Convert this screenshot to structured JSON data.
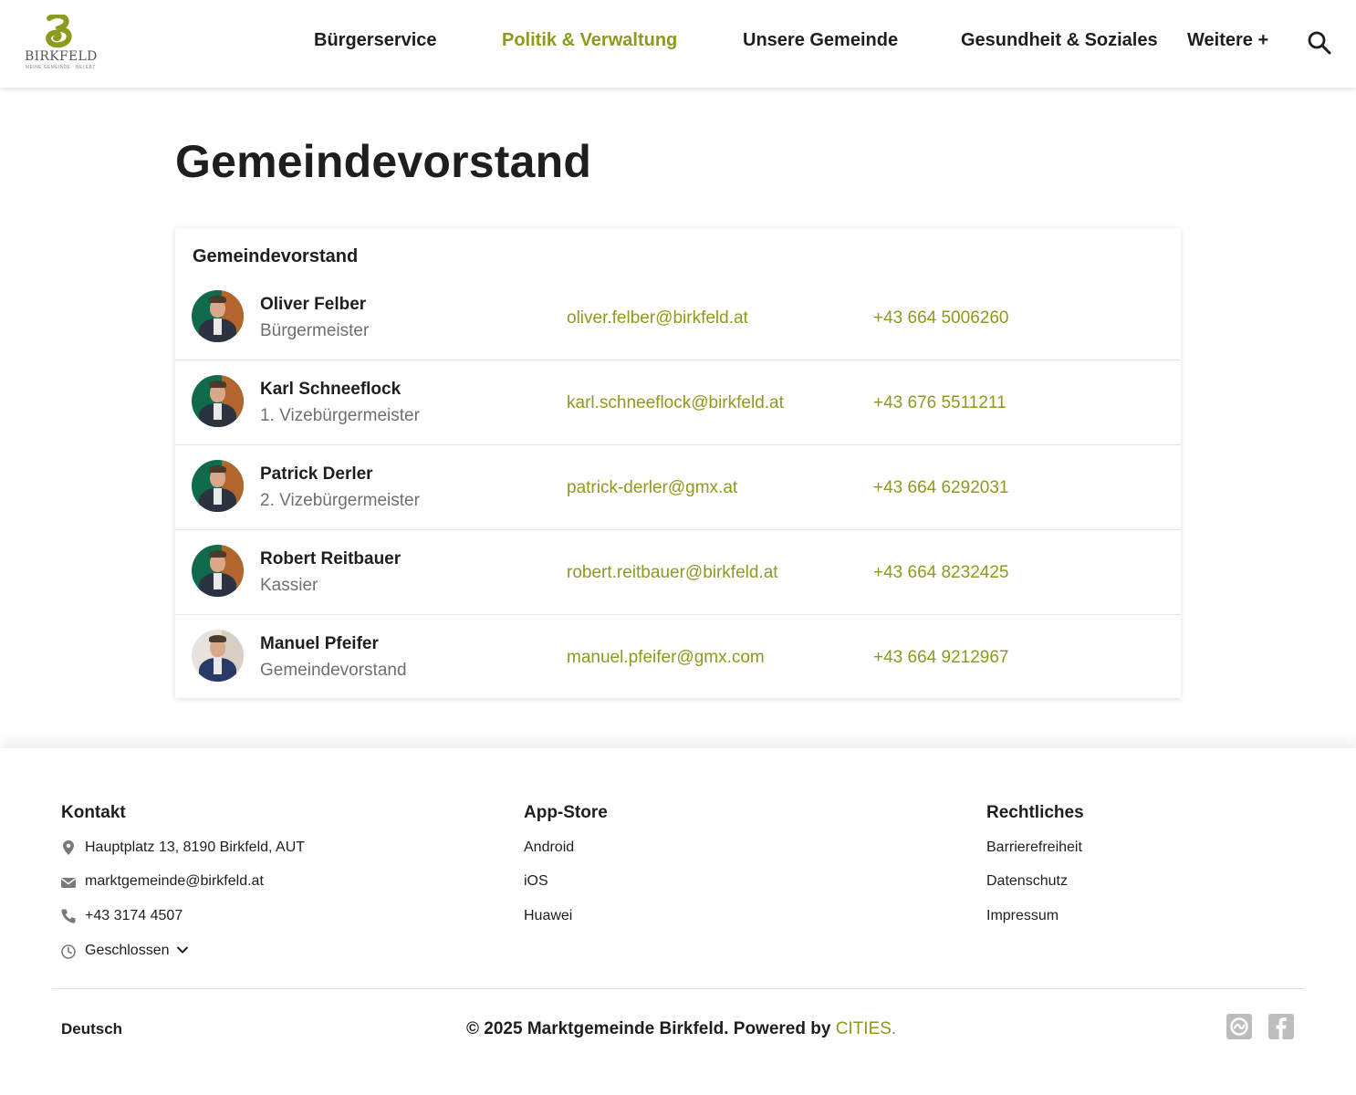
{
  "brand": {
    "name": "BIRKFELD",
    "tagline": "MEINE GEMEINDE · BELEBT",
    "color": "#8c9a1e"
  },
  "nav": {
    "items": [
      {
        "label": "Bürgerservice",
        "active": false
      },
      {
        "label": "Politik & Verwaltung",
        "active": true
      },
      {
        "label": "Unsere Gemeinde",
        "active": false
      },
      {
        "label": "Gesundheit & Soziales",
        "active": false
      },
      {
        "label": "Weitere +",
        "active": false
      }
    ],
    "search_icon": "search-icon"
  },
  "page": {
    "title": "Gemeindevorstand"
  },
  "card": {
    "title": "Gemeindevorstand",
    "members": [
      {
        "name": "Oliver Felber",
        "role": "Bürgermeister",
        "email": "oliver.felber@birkfeld.at",
        "phone": "+43 664 5006260"
      },
      {
        "name": "Karl Schneeflock",
        "role": "1. Vizebürgermeister",
        "email": "karl.schneeflock@birkfeld.at",
        "phone": "+43 676 5511211"
      },
      {
        "name": "Patrick Derler",
        "role": "2. Vizebürgermeister",
        "email": "patrick-derler@gmx.at",
        "phone": "+43 664 6292031"
      },
      {
        "name": "Robert Reitbauer",
        "role": "Kassier",
        "email": "robert.reitbauer@birkfeld.at",
        "phone": "+43 664 8232425"
      },
      {
        "name": "Manuel Pfeifer",
        "role": "Gemeindevorstand",
        "email": "manuel.pfeifer@gmx.com",
        "phone": "+43 664 9212967"
      }
    ]
  },
  "footer": {
    "kontakt": {
      "title": "Kontakt",
      "address": "Hauptplatz 13, 8190 Birkfeld, AUT",
      "email": "marktgemeinde@birkfeld.at",
      "phone": "+43 3174 4507",
      "hours": "Geschlossen"
    },
    "appstore": {
      "title": "App-Store",
      "links": [
        "Android",
        "iOS",
        "Huawei"
      ]
    },
    "legal": {
      "title": "Rechtliches",
      "links": [
        "Barrierefreiheit",
        "Datenschutz",
        "Impressum"
      ]
    },
    "language": "Deutsch",
    "copyright": "© 2025 Marktgemeinde Birkfeld. Powered by",
    "powered_by": "CITIES.",
    "social_icons": [
      "cities-icon",
      "facebook-icon"
    ]
  }
}
